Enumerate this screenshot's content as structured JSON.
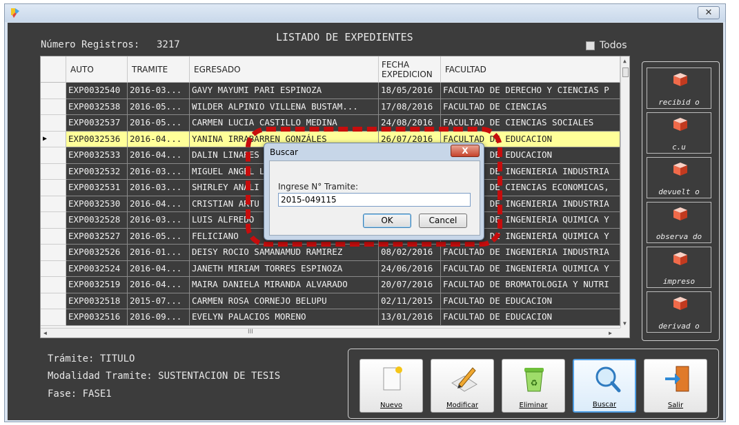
{
  "window": {
    "close_label": "✕"
  },
  "header": {
    "records_label": "Número Registros:",
    "records_count": "3217",
    "title": "LISTADO DE EXPEDIENTES",
    "todos_label": "Todos"
  },
  "grid": {
    "columns": [
      "AUTO",
      "TRAMITE",
      "EGRESADO",
      "FECHA\nEXPEDICION",
      "FACULTAD"
    ],
    "rows": [
      [
        "EXP0032540",
        "2016-03...",
        "GAVY MAYUMI PARI ESPINOZA",
        "18/05/2016",
        "FACULTAD DE DERECHO Y CIENCIAS P"
      ],
      [
        "EXP0032538",
        "2016-05...",
        "WILDER ALPINIO VILLENA BUSTAM...",
        "17/08/2016",
        "FACULTAD DE CIENCIAS"
      ],
      [
        "EXP0032537",
        "2016-05...",
        "CARMEN LUCIA CASTILLO MEDINA",
        "24/08/2016",
        "FACULTAD DE CIENCIAS SOCIALES"
      ],
      [
        "EXP0032536",
        "2016-04...",
        "YANINA IRRABARREN GONZÁLES",
        "26/07/2016",
        "FACULTAD DE EDUCACION"
      ],
      [
        "EXP0032533",
        "2016-04...",
        "DALIN LINARES",
        "",
        "FACULTAD DE EDUCACION"
      ],
      [
        "EXP0032532",
        "2016-03...",
        "MIGUEL ANGEL L",
        "",
        "FACULTAD DE INGENIERIA INDUSTRIA"
      ],
      [
        "EXP0032531",
        "2016-03...",
        "SHIRLEY ANALI",
        "",
        "FACULTAD DE CIENCIAS ECONOMICAS,"
      ],
      [
        "EXP0032530",
        "2016-04...",
        "CRISTIAN ARTU",
        "",
        "FACULTAD DE INGENIERIA INDUSTRIA"
      ],
      [
        "EXP0032528",
        "2016-03...",
        "LUIS ALFREDO",
        "",
        "FACULTAD DE INGENIERIA QUIMICA Y"
      ],
      [
        "EXP0032527",
        "2016-05...",
        "FELICIANO",
        "",
        "FACULTAD DE INGENIERIA QUIMICA Y"
      ],
      [
        "EXP0032526",
        "2016-01...",
        "DEISY ROCIO SAMANAMUD RAMIREZ",
        "08/02/2016",
        "FACULTAD DE INGENIERIA INDUSTRIA"
      ],
      [
        "EXP0032524",
        "2016-04...",
        "JANETH MIRIAM TORRES ESPINOZA",
        "24/06/2016",
        "FACULTAD DE INGENIERIA QUIMICA Y"
      ],
      [
        "EXP0032519",
        "2016-04...",
        "MAIRA DANIELA MIRANDA ALVARADO",
        "20/07/2016",
        "FACULTAD DE BROMATOLOGIA Y NUTRI"
      ],
      [
        "EXP0032518",
        "2015-07...",
        "CARMEN ROSA CORNEJO BELUPU",
        "02/11/2015",
        "FACULTAD DE EDUCACION"
      ],
      [
        "EXP0032516",
        "2016-09...",
        "EVELYN PALACIOS MORENO",
        "13/01/2016",
        "FACULTAD DE EDUCACION"
      ]
    ],
    "selected_row": 3,
    "hscroll_label": "III"
  },
  "side_buttons": [
    "recibid o",
    "c.u",
    "devuelt o",
    "observa do",
    "impreso",
    "derivad o"
  ],
  "info": {
    "tramite_label": "Trámite:",
    "tramite_value": "TITULO",
    "modalidad_label": "Modalidad Tramite:",
    "modalidad_value": "SUSTENTACION DE TESIS",
    "fase_label": "Fase:",
    "fase_value": "FASE1"
  },
  "toolbar": {
    "nuevo": "Nuevo",
    "modificar": "Modificar",
    "eliminar": "Eliminar",
    "buscar": "Buscar",
    "salir": "Salir"
  },
  "dialog": {
    "title": "Buscar",
    "close": "X",
    "prompt": "Ingrese N° Tramite:",
    "value": "2015-049115",
    "ok": "OK",
    "cancel": "Cancel"
  },
  "colors": {
    "background": "#3c3c3c",
    "selected_row": "#ffff99",
    "highlight_ring": "#c70d0d",
    "side_icon": "#e2533a"
  }
}
